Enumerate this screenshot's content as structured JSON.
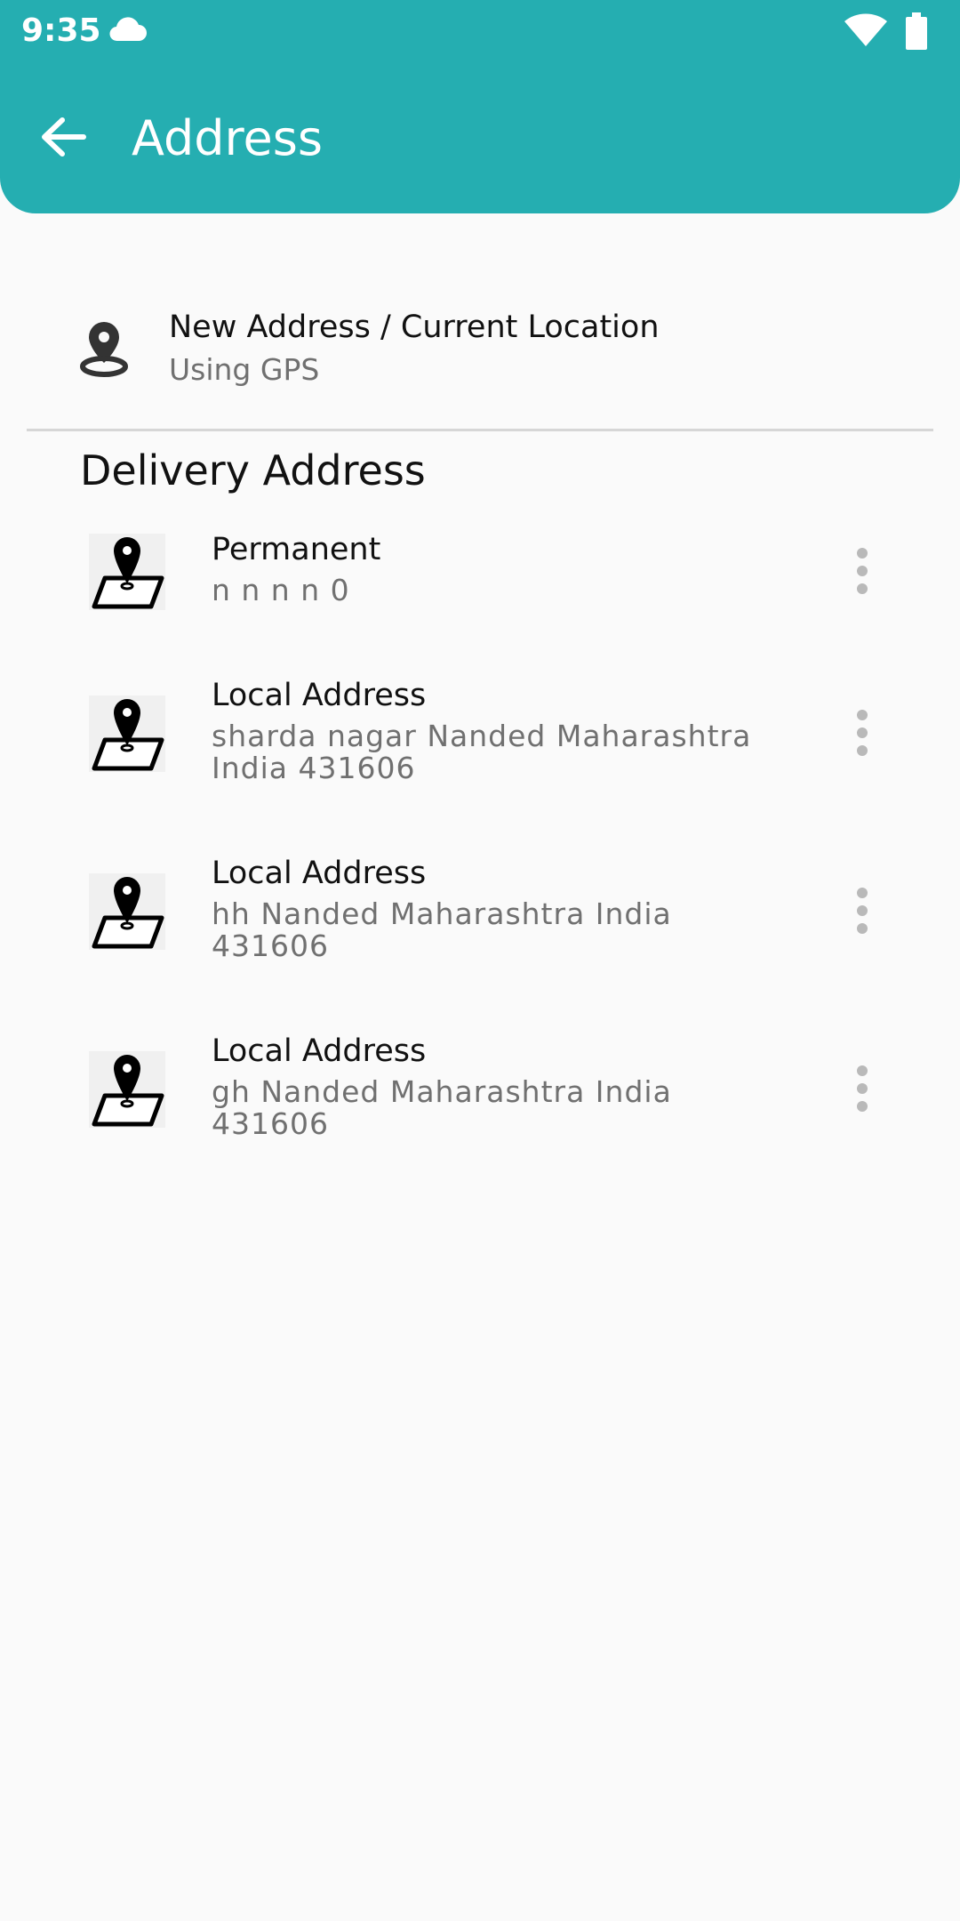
{
  "status_bar": {
    "time": "9:35",
    "icons": [
      "cloud-icon",
      "wifi-icon",
      "battery-icon"
    ]
  },
  "app_bar": {
    "title": "Address",
    "back_icon": "arrow-back-icon",
    "color": "#25aeb1"
  },
  "gps_option": {
    "title": "New Address / Current Location",
    "subtitle": "Using GPS",
    "icon": "location-pin-icon"
  },
  "section": {
    "title": "Delivery Address"
  },
  "addresses": [
    {
      "label": "Permanent",
      "line1": "n n n n 0",
      "line2": "",
      "icon": "map-pin-icon",
      "menu_icon": "more-vert-icon"
    },
    {
      "label": "Local Address",
      "line1": "sharda nagar Nanded Maharashtra",
      "line2": "India 431606",
      "icon": "map-pin-icon",
      "menu_icon": "more-vert-icon"
    },
    {
      "label": "Local Address",
      "line1": "hh Nanded Maharashtra India",
      "line2": "431606",
      "icon": "map-pin-icon",
      "menu_icon": "more-vert-icon"
    },
    {
      "label": "Local Address",
      "line1": "gh Nanded Maharashtra India",
      "line2": "431606",
      "icon": "map-pin-icon",
      "menu_icon": "more-vert-icon"
    }
  ]
}
